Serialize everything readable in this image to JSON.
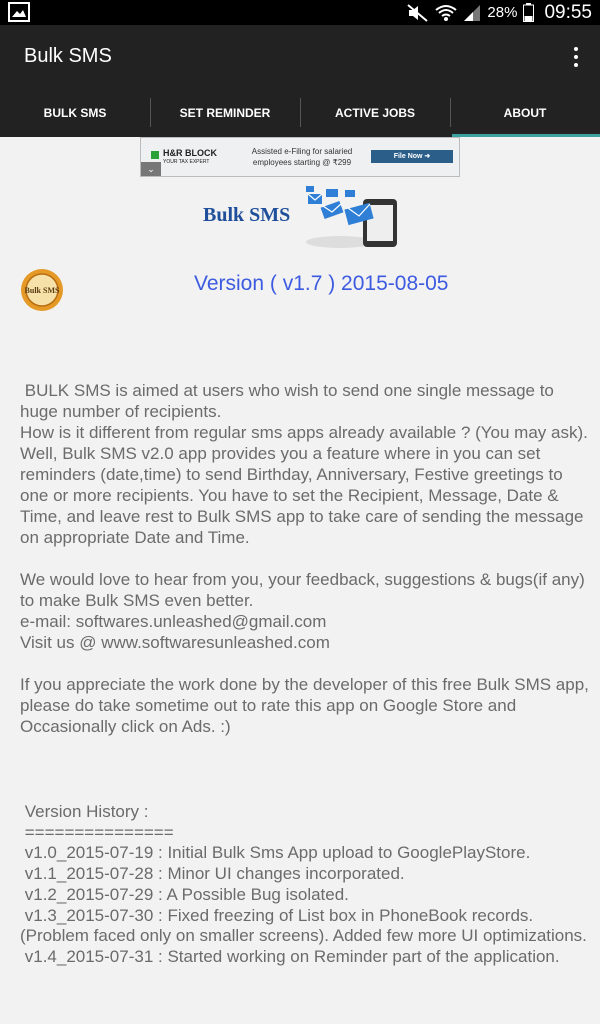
{
  "status_bar": {
    "battery_percent": "28%",
    "time": "09:55",
    "icons": [
      "gallery-icon",
      "mute-icon",
      "wifi-icon",
      "signal-icon",
      "battery-icon"
    ]
  },
  "app_bar": {
    "title": "Bulk SMS",
    "overflow_icon": "more-vert-icon"
  },
  "tabs": [
    {
      "label": "BULK SMS",
      "active": false
    },
    {
      "label": "SET REMINDER",
      "active": false
    },
    {
      "label": "ACTIVE JOBS",
      "active": false
    },
    {
      "label": "ABOUT",
      "active": true
    }
  ],
  "ad": {
    "brand": "H&R BLOCK",
    "tagline": "YOUR TAX EXPERT",
    "text": "Assisted e-Filing for salaried employees starting @ ₹299",
    "button": "File Now ➜"
  },
  "about": {
    "logo_text": "Bulk SMS",
    "badge_text": "Bulk SMS",
    "version": "Version ( v1.7 ) 2015-08-05",
    "description": " BULK SMS is aimed at users who wish to send one single message to huge number of recipients.\nHow is it different from regular sms apps already available ? (You may ask).\nWell, Bulk SMS v2.0 app provides you a feature where in you can set reminders (date,time) to send Birthday, Anniversary, Festive greetings to one or more recipients. You have to set the Recipient, Message, Date & Time, and leave rest to Bulk SMS app to take care of sending the message on appropriate Date and Time.\n\nWe would love to hear from you, your feedback, suggestions & bugs(if any) to make Bulk SMS even better.\ne-mail: softwares.unleashed@gmail.com\nVisit us @ www.softwaresunleashed.com\n\nIf you appreciate the work done by the developer of this free Bulk SMS app, please do take sometime out to rate this app on Google Store and Occasionally click on Ads. :)",
    "history": " Version History :\n ===============\n v1.0_2015-07-19 : Initial Bulk Sms App upload to GooglePlayStore.\n v1.1_2015-07-28 : Minor UI changes incorporated.\n v1.2_2015-07-29 : A Possible Bug isolated.\n v1.3_2015-07-30 : Fixed freezing of List box in PhoneBook records.(Problem faced only on smaller screens). Added few more UI optimizations.\n v1.4_2015-07-31 : Started working on Reminder part of the application."
  },
  "colors": {
    "background": "#f2f2f2",
    "app_bar": "#222222",
    "tab_indicator": "#3aa0a0",
    "version_text": "#3d5be0",
    "logo_text": "#1f4e9a"
  }
}
